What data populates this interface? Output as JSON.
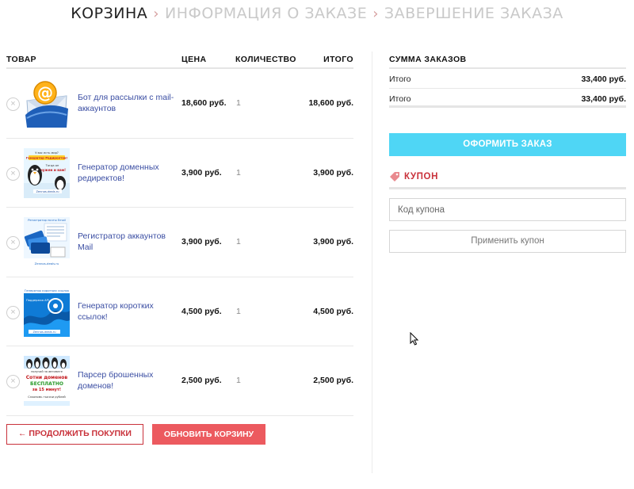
{
  "steps": [
    {
      "label": "КОРЗИНА"
    },
    {
      "label": "ИНФОРМАЦИЯ О ЗАКАЗЕ"
    },
    {
      "label": "ЗАВЕРШЕНИЕ ЗАКАЗА"
    }
  ],
  "step_separator": "›",
  "cart": {
    "headers": {
      "product": "ТОВАР",
      "price": "ЦЕНА",
      "quantity": "КОЛИЧЕСТВО",
      "total": "ИТОГО"
    },
    "items": [
      {
        "name": "Бот для рассылки с mail-аккаунтов",
        "price": "18,600 руб.",
        "quantity": "1",
        "total": "18,600 руб.",
        "thumb": "email-at-icon"
      },
      {
        "name": "Генератор доменных редиректов!",
        "price": "3,900 руб.",
        "quantity": "1",
        "total": "3,900 руб.",
        "thumb": "penguin-banner"
      },
      {
        "name": "Регистратор аккаунтов Mail",
        "price": "3,900 руб.",
        "quantity": "1",
        "total": "3,900 руб.",
        "thumb": "cards-banner"
      },
      {
        "name": "Генератор коротких ссылок!",
        "price": "4,500 руб.",
        "quantity": "1",
        "total": "4,500 руб.",
        "thumb": "wave-banner"
      },
      {
        "name": "Парсер брошенных доменов!",
        "price": "2,500 руб.",
        "quantity": "1",
        "total": "2,500 руб.",
        "thumb": "penguins-free-banner"
      }
    ],
    "remove_symbol": "×",
    "continue_label": "← ПРОДОЛЖИТЬ ПОКУПКИ",
    "update_label": "ОБНОВИТЬ КОРЗИНУ"
  },
  "totals": {
    "title": "СУММА ЗАКАЗОВ",
    "rows": [
      {
        "label": "Итого",
        "value": "33,400 руб."
      },
      {
        "label": "Итого",
        "value": "33,400 руб."
      }
    ],
    "checkout_label": "ОФОРМИТЬ ЗАКАЗ"
  },
  "coupon": {
    "title": "КУПОН",
    "placeholder": "Код купона",
    "apply_label": "Применить купон"
  },
  "colors": {
    "accent_red": "#c9323b",
    "update_button": "#ec5a5f",
    "checkout_button": "#4fd6f5",
    "link_blue": "#3b4ea3"
  },
  "thumb_text": {
    "banner2": {
      "l1": "У вас есть мир?",
      "l2": "Генератор Редиректов!",
      "l3": "Тогда он",
      "l4": "нужен и вам!",
      "l5": "Zennos-deals.ru"
    },
    "banner3": {
      "l1": "Регистратор почты Email",
      "l2": "Zennos-deals.ru"
    },
    "banner4": {
      "l1": "Генератор коротких ссылок",
      "l2": "Поддержка API",
      "l3": "Zennos-deals.ru"
    },
    "banner5": {
      "l1": "получай за автомате",
      "l2": "Сотни доменов",
      "l3": "БЕСПЛАТНО",
      "l4": "за 15 минут!",
      "l5": "Сэкономь тысячи рублей"
    }
  }
}
